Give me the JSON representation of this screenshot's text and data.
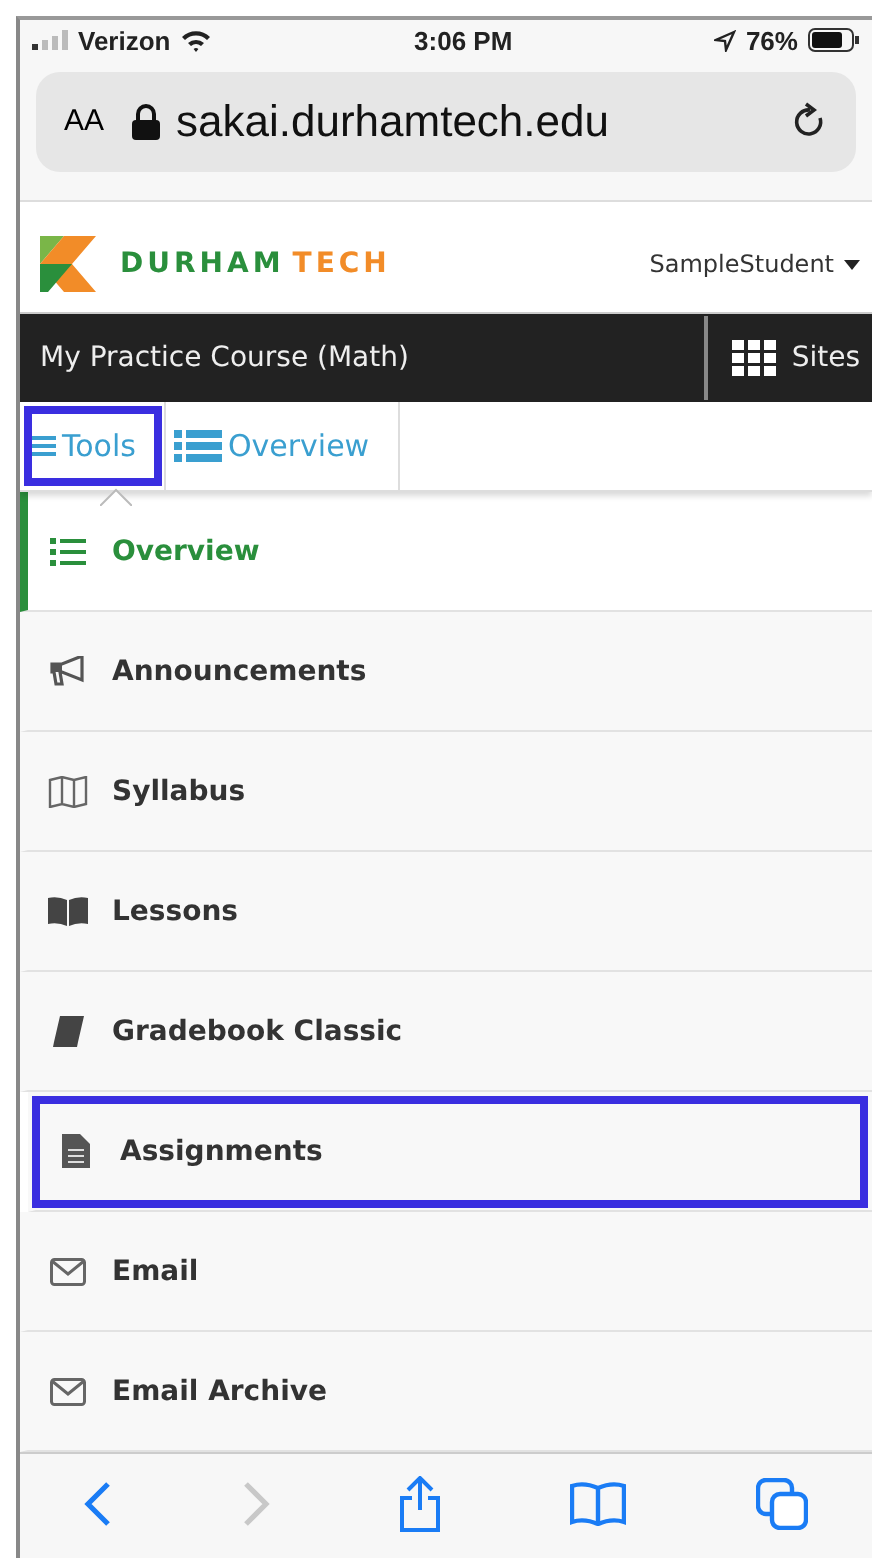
{
  "status_bar": {
    "carrier": "Verizon",
    "time": "3:06 PM",
    "battery": "76%"
  },
  "address_bar": {
    "text_size": "AA",
    "url": "sakai.durhamtech.edu"
  },
  "header": {
    "logo_text_1": "DURHAM",
    "logo_text_2": "TECH",
    "user": "SampleStudent"
  },
  "course_bar": {
    "title": "My Practice Course (Math)",
    "sites": "Sites"
  },
  "tabs": [
    {
      "label": "Tools",
      "selected": true,
      "highlighted": true
    },
    {
      "label": "Overview",
      "selected": false,
      "highlighted": false
    }
  ],
  "tools": [
    {
      "label": "Overview",
      "kind": "list",
      "selected": true,
      "highlighted": false
    },
    {
      "label": "Announcements",
      "kind": "megaphone",
      "selected": false,
      "highlighted": false
    },
    {
      "label": "Syllabus",
      "kind": "map",
      "selected": false,
      "highlighted": false
    },
    {
      "label": "Lessons",
      "kind": "book-open",
      "selected": false,
      "highlighted": false
    },
    {
      "label": "Gradebook Classic",
      "kind": "book",
      "selected": false,
      "highlighted": false
    },
    {
      "label": "Assignments",
      "kind": "file",
      "selected": false,
      "highlighted": true
    },
    {
      "label": "Email",
      "kind": "envelope",
      "selected": false,
      "highlighted": false
    },
    {
      "label": "Email Archive",
      "kind": "envelope",
      "selected": false,
      "highlighted": false
    }
  ],
  "toolbar": {
    "forward_disabled": true
  }
}
